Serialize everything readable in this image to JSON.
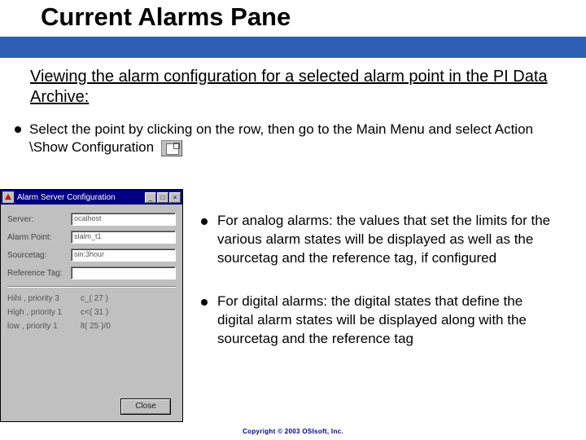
{
  "slide": {
    "title": "Current Alarms Pane",
    "subtitle_prefix": "Viewing the alarm configuration for a selected alarm point in the PI Data Archive:",
    "main_bullet": "Select the point by clicking on the row, then go to the Main Menu and select Action \\Show Configuration",
    "right_bullets": [
      "For analog alarms: the values that set the limits for the various alarm states will be displayed as well as the sourcetag and the reference tag, if configured",
      "For digital alarms: the digital states that define the digital alarm states will be displayed along with the sourcetag and the reference tag"
    ]
  },
  "dialog": {
    "title": "Alarm Server Configuration",
    "fields": {
      "server_label": "Server:",
      "server_value": "ocalhost",
      "alarm_point_label": "Alarm Point:",
      "alarm_point_value": "slalm_t1",
      "sourcetag_label": "Sourcetag:",
      "sourcetag_value": "sin:3hour",
      "reference_tag_label": "Reference Tag:",
      "reference_tag_value": ""
    },
    "limits": [
      {
        "label": "Hihi , priority 3",
        "value": "c_( 27 )"
      },
      {
        "label": "High , priority 1",
        "value": "c<( 31 )"
      },
      {
        "label": "low , priority 1",
        "value": "lt( 25 )/0"
      }
    ],
    "close_label": "Close"
  },
  "copyright": "Copyright © 2003 OSIsoft, Inc."
}
